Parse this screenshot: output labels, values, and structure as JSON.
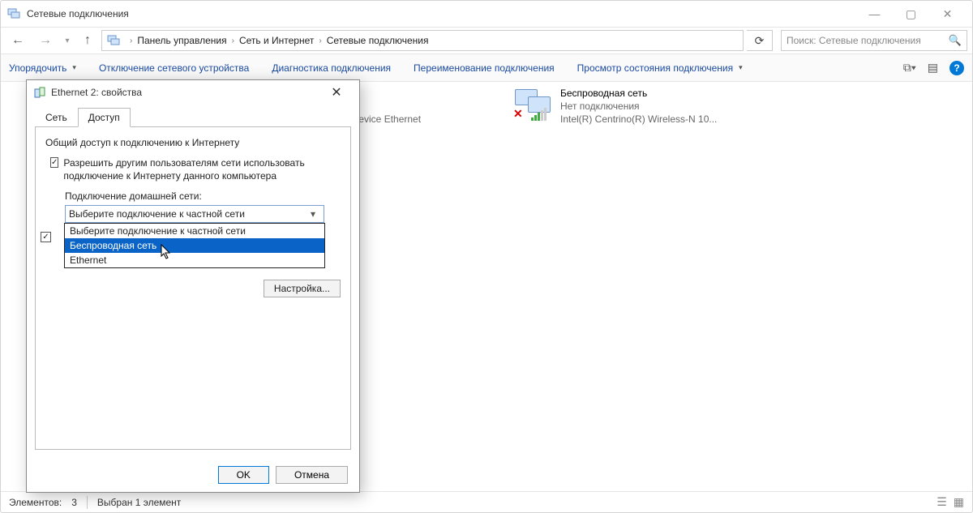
{
  "window": {
    "title": "Сетевые подключения",
    "search_placeholder": "Поиск: Сетевые подключения"
  },
  "breadcrumb": {
    "items": [
      "Панель управления",
      "Сеть и Интернет",
      "Сетевые подключения"
    ]
  },
  "commandbar": {
    "organize": "Упорядочить",
    "disable": "Отключение сетевого устройства",
    "diagnose": "Диагностика подключения",
    "rename": "Переименование подключения",
    "status": "Просмотр состояния подключения"
  },
  "connections": {
    "partial": {
      "line3": "le Device Ethernet"
    },
    "wifi": {
      "name": "Беспроводная сеть",
      "status": "Нет подключения",
      "device": "Intel(R) Centrino(R) Wireless-N 10..."
    }
  },
  "statusbar": {
    "count_label": "Элементов:",
    "count_value": "3",
    "selection": "Выбран 1 элемент"
  },
  "dialog": {
    "title": "Ethernet 2: свойства",
    "tabs": {
      "network": "Сеть",
      "sharing": "Доступ"
    },
    "group": "Общий доступ к подключению к Интернету",
    "chk1": "Разрешить другим пользователям сети использовать подключение к Интернету данного компьютера",
    "home_label": "Подключение домашней сети:",
    "combo_value": "Выберите подключение к частной сети",
    "dropdown": {
      "opt0": "Выберите подключение к частной сети",
      "opt1": "Беспроводная сеть",
      "opt2": "Ethernet"
    },
    "settings_btn": "Настройка...",
    "ok": "OK",
    "cancel": "Отмена"
  }
}
